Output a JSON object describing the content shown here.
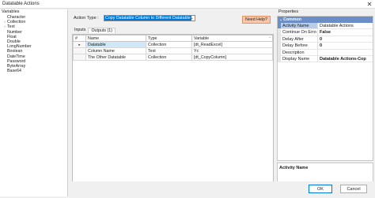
{
  "window": {
    "title": "Datatable Actions",
    "close_glyph": "✕"
  },
  "variables": {
    "header": "Variables",
    "items": [
      {
        "label": "Character",
        "expander": ""
      },
      {
        "label": "Collection",
        "expander": "›"
      },
      {
        "label": "Text",
        "expander": "›"
      },
      {
        "label": "Number",
        "expander": ""
      },
      {
        "label": "Float",
        "expander": ""
      },
      {
        "label": "Double",
        "expander": ""
      },
      {
        "label": "LongNumber",
        "expander": ""
      },
      {
        "label": "Boolean",
        "expander": ""
      },
      {
        "label": "DateTime",
        "expander": ""
      },
      {
        "label": "Password",
        "expander": ""
      },
      {
        "label": "ByteArray",
        "expander": ""
      },
      {
        "label": "Base64",
        "expander": ""
      }
    ]
  },
  "action": {
    "label": "Action Type :",
    "selected": "Copy Datatable Column to Different Datatable",
    "caret": "⌄"
  },
  "help_button": "Need Help?",
  "tabs": [
    {
      "label": "Inputs"
    },
    {
      "label": "Outputs (1)"
    }
  ],
  "grid": {
    "columns": [
      "#",
      "Name",
      "Type",
      "Variable"
    ],
    "sort_glyph": "⌃",
    "rows": [
      {
        "marker": "▸",
        "name": "Datatable",
        "type": "Collection",
        "variable": "[dt_ReadExcel]"
      },
      {
        "marker": "",
        "name": "Column Name",
        "type": "Text",
        "variable": "Yc"
      },
      {
        "marker": "",
        "name": "The Other Datatable",
        "type": "Collection",
        "variable": "[dt_CopyColumn]"
      }
    ]
  },
  "properties": {
    "header": "Properties",
    "group": "Common",
    "group_glyph": "⌄",
    "rows": [
      {
        "key": "Activity Name",
        "value": "Datatable Actions"
      },
      {
        "key": "Continue On Erro",
        "value": "False"
      },
      {
        "key": "Delay After",
        "value": "0"
      },
      {
        "key": "Delay Before",
        "value": "0"
      },
      {
        "key": "Description",
        "value": ""
      },
      {
        "key": "Display Name",
        "value": "Datatable Actions-Cop"
      }
    ],
    "description_title": "Activity Name"
  },
  "footer": {
    "ok": "OK",
    "cancel": "Cancel"
  },
  "colors": {
    "accent": "#0078d7",
    "help": "#f9c7a8",
    "group": "#6b8ec7"
  }
}
